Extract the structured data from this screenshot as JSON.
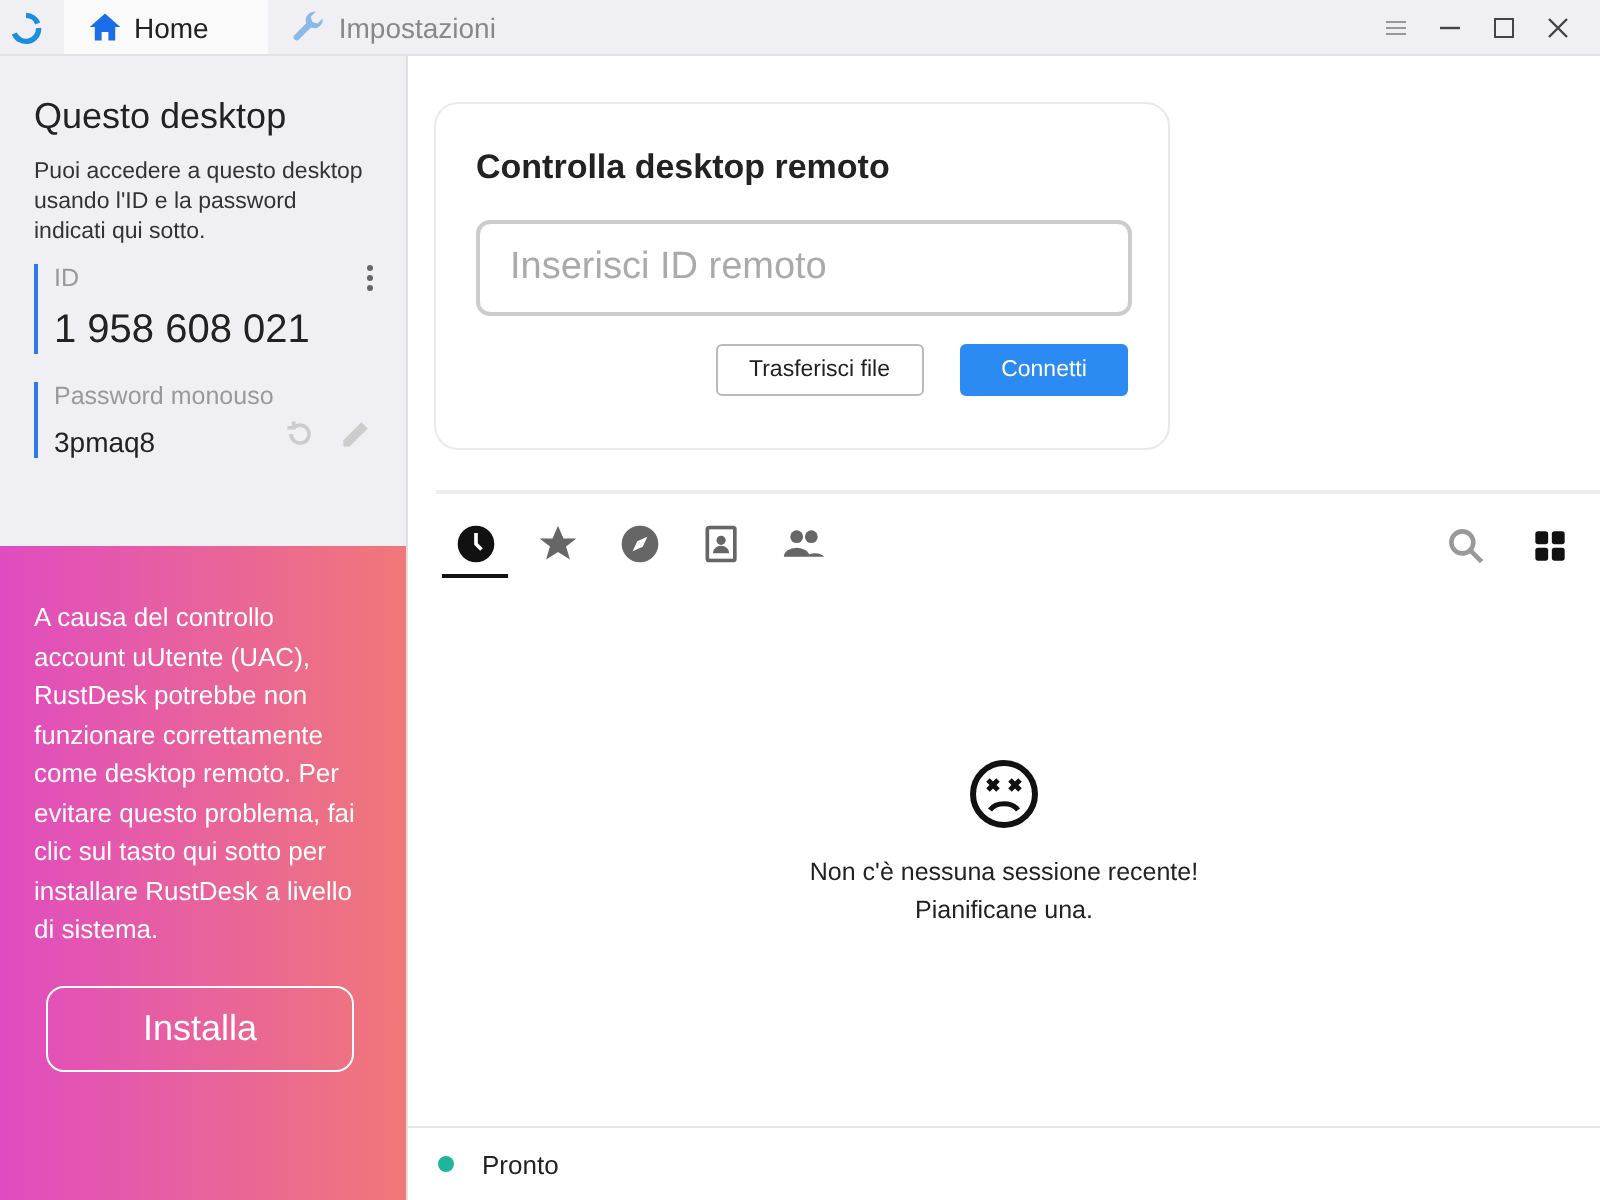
{
  "tabs": [
    {
      "label": "Home",
      "kind": "home",
      "selected": true
    },
    {
      "label": "Impostazioni",
      "kind": "settings",
      "selected": false
    }
  ],
  "sidebar": {
    "title": "Questo desktop",
    "description": "Puoi accedere a questo desktop usando l'ID e la password indicati qui sotto.",
    "id_label": "ID",
    "id_value": "1 958 608 021",
    "password_label": "Password monouso",
    "password_value": "3pmaq8"
  },
  "warning": {
    "text": "A causa del controllo account uUtente (UAC), RustDesk potrebbe non funzionare correttamente come desktop remoto. Per evitare questo problema, fai clic sul tasto qui sotto per installare RustDesk a livello di sistema.",
    "button": "Installa"
  },
  "connect": {
    "title": "Controlla desktop remoto",
    "placeholder": "Inserisci ID remoto",
    "buttons": [
      {
        "label": "Trasferisci file",
        "kind": "outline"
      },
      {
        "label": "Connetti",
        "kind": "primary"
      }
    ]
  },
  "peer_tabs": [
    {
      "kind": "recent",
      "selected": true
    },
    {
      "kind": "favorites",
      "selected": false
    },
    {
      "kind": "discovered",
      "selected": false
    },
    {
      "kind": "address-book",
      "selected": false
    },
    {
      "kind": "group",
      "selected": false
    }
  ],
  "empty_state": {
    "lines": [
      "Non c'è nessuna sessione recente!",
      "Pianificane una."
    ]
  },
  "status_bar": {
    "text": "Pronto",
    "color": "#1fb59a"
  }
}
